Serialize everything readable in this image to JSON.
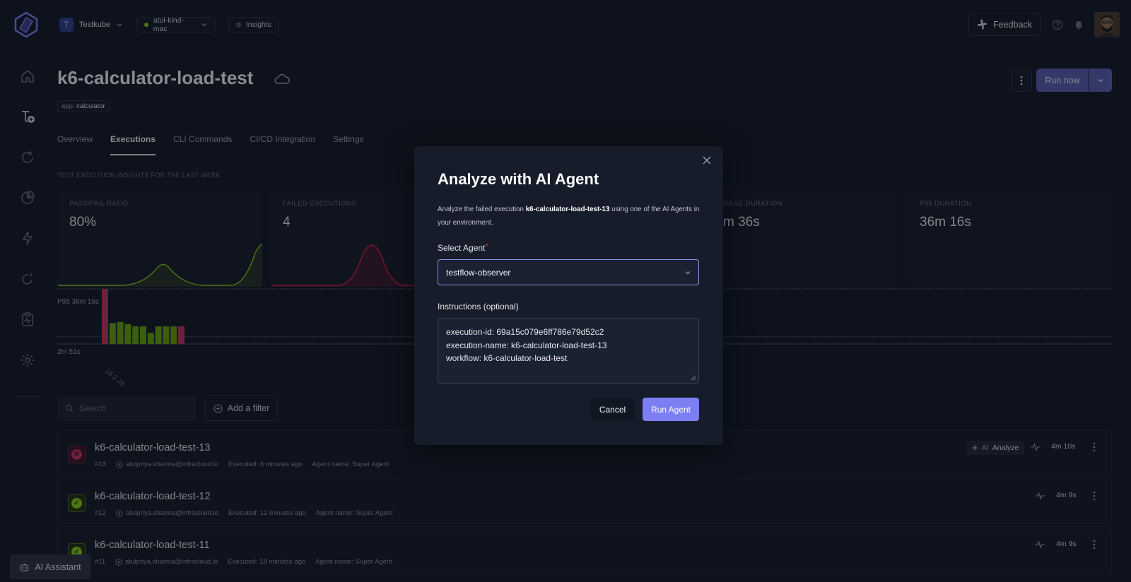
{
  "topbar": {
    "org_initial": "T",
    "org_name": "Testkube",
    "env_name": "atul-kind-mac",
    "insights_label": "Insights",
    "feedback_label": "Feedback"
  },
  "header": {
    "title": "k6-calculator-load-test",
    "tag_key": "app:",
    "tag_value": "calculator",
    "run_now_label": "Run now"
  },
  "tabs": [
    {
      "label": "Overview"
    },
    {
      "label": "Executions"
    },
    {
      "label": "CLI Commands"
    },
    {
      "label": "CI/CD Integration"
    },
    {
      "label": "Settings"
    }
  ],
  "insights": {
    "section_label": "TEST EXECUTION INSIGHTS FOR THE LAST WEEK",
    "cards": [
      {
        "label": "PASS/FAIL RATIO",
        "value": "80%"
      },
      {
        "label": "FAILED EXECUTIONS",
        "value": "4"
      },
      {
        "label": "RAGE DURATION",
        "value": "m 36s"
      },
      {
        "label": "P95 DURATION",
        "value": "36m 16s"
      }
    ],
    "colors": {
      "pass": "#84cc16",
      "fail": "#e11d48"
    }
  },
  "exec_chart": {
    "p95_label": "P95 36m 16s",
    "min_label": "2m 51s",
    "date_label": "24.2.26",
    "bars": [
      "fail",
      "pass",
      "pass",
      "pass",
      "pass",
      "pass",
      "pass",
      "pass",
      "pass",
      "pass",
      "fail"
    ],
    "bar_levels": [
      1.0,
      0.38,
      0.4,
      0.36,
      0.32,
      0.32,
      0.2,
      0.32,
      0.32,
      0.32,
      0.32
    ]
  },
  "filters": {
    "search_placeholder": "Search",
    "add_filter_label": "Add a filter"
  },
  "executions": [
    {
      "name": "k6-calculator-load-test-13",
      "number": "#13",
      "user": "atulpriya.sharma@infracloud.io",
      "executed": "Executed: 6 minutes ago",
      "agent": "Agent name: Super Agent",
      "duration": "4m 10s",
      "status": "failed",
      "ai_prefix": "AI",
      "ai_label": "Analyze"
    },
    {
      "name": "k6-calculator-load-test-12",
      "number": "#12",
      "user": "atulpriya.sharma@infracloud.io",
      "executed": "Executed: 12 minutes ago",
      "agent": "Agent name: Super Agent",
      "duration": "4m 9s",
      "status": "passed"
    },
    {
      "name": "k6-calculator-load-test-11",
      "number": "#11",
      "user": "atulpriya.sharma@infracloud.io",
      "executed": "Executed: 18 minutes ago",
      "agent": "Agent name: Super Agent",
      "duration": "4m 9s",
      "status": "passed"
    }
  ],
  "ai_assistant_label": "AI Assistant",
  "modal": {
    "title": "Analyze with AI Agent",
    "desc_before": "Analyze the failed execution ",
    "desc_execution": "k6-calculator-load-test-13",
    "desc_after": " using one of the AI Agents in your environment.",
    "select_label": "Select Agent",
    "required_mark": "*",
    "selected_agent": "testflow-observer",
    "instructions_label": "Instructions (optional)",
    "instructions_lines": [
      "execution-id: 69a15c079e6ff786e79d52c2",
      "execution-name: k6-calculator-load-test-13",
      "workflow: k6-calculator-load-test"
    ],
    "cancel_label": "Cancel",
    "run_label": "Run Agent"
  }
}
